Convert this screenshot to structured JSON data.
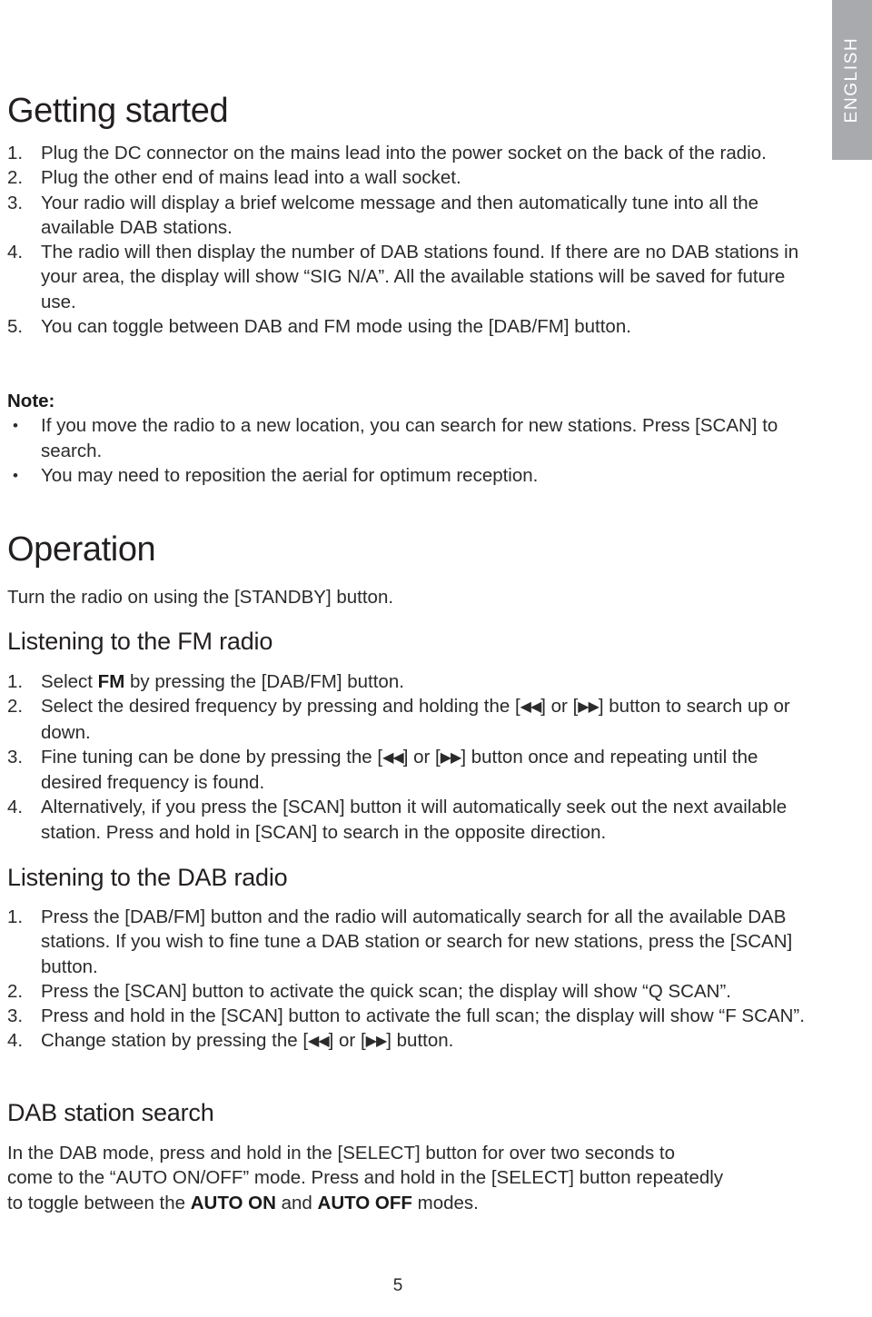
{
  "language_tab": {
    "label": "ENGLISH"
  },
  "sections": {
    "getting_started": {
      "title": "Getting started",
      "items": [
        {
          "marker": "1.",
          "text": "Plug the DC connector on the mains lead into the power socket on the back of the radio."
        },
        {
          "marker": "2.",
          "text": "Plug the other end of mains lead into a wall socket."
        },
        {
          "marker": "3.",
          "text": "Your radio will display a brief welcome message and then automatically tune into all the available DAB stations."
        },
        {
          "marker": "4.",
          "text": "The radio will then display the number of DAB stations found. If there are no DAB stations in your area, the display will show “SIG N/A”. All the available stations will be saved for future use."
        },
        {
          "marker": "5.",
          "text": "You can toggle between DAB and FM mode using the [DAB/FM] button."
        }
      ]
    },
    "note": {
      "label": "Note:",
      "items": [
        {
          "marker": "•",
          "text": "If you move the radio to a new location, you can search for new stations. Press [SCAN] to search."
        },
        {
          "marker": "•",
          "text": "You may need to reposition the aerial for optimum reception."
        }
      ]
    },
    "operation": {
      "title": "Operation",
      "intro": "Turn the radio on using the [STANDBY] button."
    },
    "fm_radio": {
      "title": "Listening to the FM radio",
      "items": [
        {
          "marker": "1.",
          "prefix": "Select ",
          "bold": "FM",
          "suffix": " by pressing the [DAB/FM] button."
        },
        {
          "marker": "2.",
          "prefix": "Select the desired frequency by pressing and holding the [",
          "arrow_left": "◀◀",
          "mid": "] or [",
          "arrow_right": "▶▶",
          "suffix": "] button to search up or down."
        },
        {
          "marker": "3.",
          "prefix": "Fine tuning can be done by pressing the [",
          "arrow_left": "◀◀",
          "mid": "] or [",
          "arrow_right": "▶▶",
          "suffix": "] button once and repeating until the desired frequency is found."
        },
        {
          "marker": "4.",
          "prefix": "Alternatively, if you press the [SCAN] button it will automatically seek out the next available station. Press and hold in [SCAN] to search in the opposite direction."
        }
      ]
    },
    "dab_radio": {
      "title": "Listening to the DAB radio",
      "items": [
        {
          "marker": "1.",
          "prefix": "Press the [DAB/FM] button and the radio will automatically search for all the available DAB stations. If you wish to fine tune a DAB station or search for new stations, press the [SCAN] button."
        },
        {
          "marker": "2.",
          "prefix": "Press the [SCAN] button to activate the quick scan; the display will show “Q SCAN”."
        },
        {
          "marker": "3.",
          "prefix": "Press and hold in the [SCAN] button to activate the full scan; the display will show “F SCAN”."
        },
        {
          "marker": "4.",
          "prefix": "Change station by pressing the [",
          "arrow_left": "◀◀",
          "mid": "] or [",
          "arrow_right": "▶▶",
          "suffix": "] button."
        }
      ]
    },
    "dab_station_search": {
      "title": "DAB station search",
      "para_part1": "In the DAB mode, press and hold in the [SELECT] button for over two seconds to come to the “AUTO ON/OFF” mode. Press and hold in the [SELECT] button repeatedly to toggle between the ",
      "bold1": "AUTO ON",
      "para_part2": " and ",
      "bold2": "AUTO OFF",
      "para_part3": " modes."
    }
  },
  "footer": {
    "page_number": "5"
  },
  "colors": {
    "tab_background": "#a9aaae",
    "tab_text": "#ffffff",
    "body_text": "#2b2b2b"
  }
}
